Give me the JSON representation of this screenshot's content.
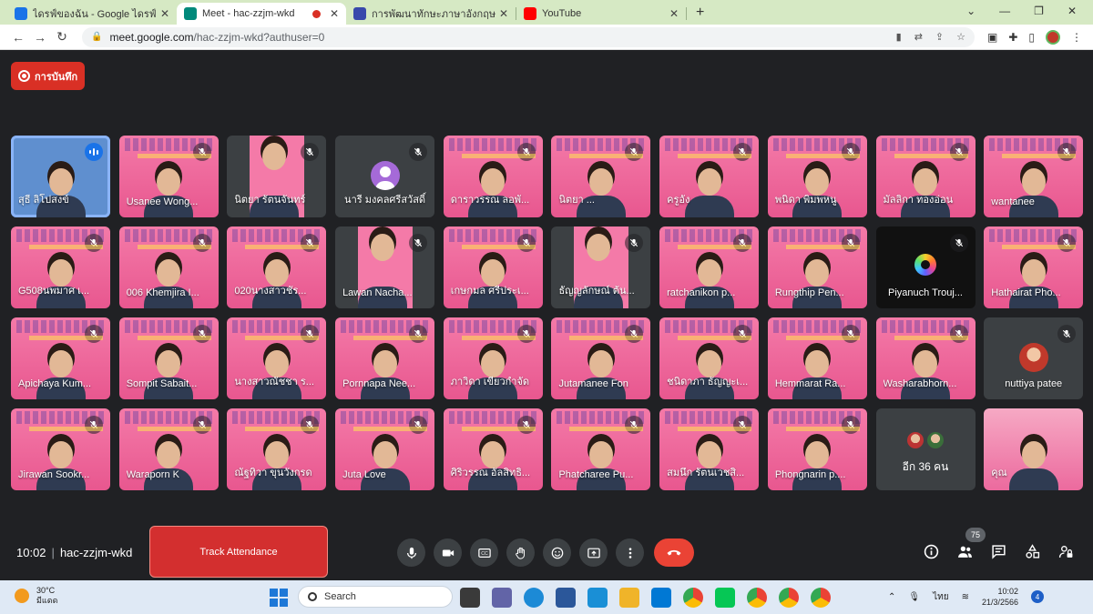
{
  "browser": {
    "tabs": [
      {
        "title": "ไดรฟ์ของฉัน - Google ไดรฟ์",
        "icon": "drive-icon",
        "color": "#1a73e8"
      },
      {
        "title": "Meet - hac-zzjm-wkd",
        "icon": "meet-icon",
        "color": "#00897b"
      },
      {
        "title": "การพัฒนาทักษะภาษาอังกฤษ English",
        "icon": "forms-icon",
        "color": "#3949ab"
      },
      {
        "title": "YouTube",
        "icon": "youtube-icon",
        "color": "#ff0000"
      }
    ],
    "url_host": "meet.google.com",
    "url_path": "/hac-zzjm-wkd?authuser=0"
  },
  "recording": {
    "label": "การบันทึก"
  },
  "participants": [
    {
      "name": "สุธี ลิโปสงข์",
      "style": "active-speaker",
      "speaking": true
    },
    {
      "name": "Usanee Wong...",
      "style": "slide"
    },
    {
      "name": "นิตยา รัตนจันทร์",
      "style": "dark-photo"
    },
    {
      "name": "นารี มงคลศรีสวัสดิ์",
      "style": "avatar"
    },
    {
      "name": "ดาราวรรณ ลอพั...",
      "style": "slide"
    },
    {
      "name": "นิตยา ...",
      "style": "slide"
    },
    {
      "name": "ครูอัง",
      "style": "slide"
    },
    {
      "name": "พนิดา พิมพหนู",
      "style": "slide"
    },
    {
      "name": "มัลลิกา ทองอ่อน",
      "style": "slide"
    },
    {
      "name": "wantanee",
      "style": "slide"
    },
    {
      "name": "G508นพมาศ เ...",
      "style": "slide"
    },
    {
      "name": "006 Khemjira I...",
      "style": "slide"
    },
    {
      "name": "020นางสาวชัร...",
      "style": "slide"
    },
    {
      "name": "Lawan Nacha...",
      "style": "dark-photo"
    },
    {
      "name": "เกษกมล ศรีประเ...",
      "style": "slide"
    },
    {
      "name": "ธัญญลักษณ์ ต้น...",
      "style": "dark-photo"
    },
    {
      "name": "ratchanikon p...",
      "style": "slide"
    },
    {
      "name": "Rungthip Pen...",
      "style": "slide"
    },
    {
      "name": "Piyanuch Trouj...",
      "style": "logo"
    },
    {
      "name": "Hathairat Pho...",
      "style": "slide"
    },
    {
      "name": "Apichaya Kum...",
      "style": "slide"
    },
    {
      "name": "Sompit Sabait...",
      "style": "slide"
    },
    {
      "name": "นางสาวณัชชา ร...",
      "style": "slide"
    },
    {
      "name": "Pornnapa Nee...",
      "style": "slide"
    },
    {
      "name": "ภาวิดา เขียวกำจัด",
      "style": "slide"
    },
    {
      "name": "Jutamanee Fon",
      "style": "slide"
    },
    {
      "name": "ชนิดาภา ธัญญะเ...",
      "style": "slide"
    },
    {
      "name": "Hemmarat Ra...",
      "style": "slide"
    },
    {
      "name": "Washarabhorn...",
      "style": "slide"
    },
    {
      "name": "nuttiya patee",
      "style": "photo-avatar"
    },
    {
      "name": "Jirawan Sookr...",
      "style": "slide"
    },
    {
      "name": "Waraporn K",
      "style": "slide"
    },
    {
      "name": "ณัฐทิวา ขุนวังกรด",
      "style": "slide"
    },
    {
      "name": "Juta Love",
      "style": "slide"
    },
    {
      "name": "ศิริวรรณ อัลสิทธิ...",
      "style": "slide"
    },
    {
      "name": "Phatcharee Pu...",
      "style": "slide"
    },
    {
      "name": "สมนึก รัตนเวชสิ...",
      "style": "room"
    },
    {
      "name": "Phongnarin p....",
      "style": "slide"
    },
    {
      "name": "อีก 36 คน",
      "style": "more"
    },
    {
      "name": "คุณ",
      "style": "self"
    }
  ],
  "bottom": {
    "time": "10:02",
    "meeting_code": "hac-zzjm-wkd",
    "track_label": "Track Attendance",
    "people_count": "75"
  },
  "taskbar": {
    "temperature": "30°C",
    "weather": "มีแดด",
    "search_placeholder": "Search",
    "language": "ไทย",
    "clock_time": "10:02",
    "clock_date": "21/3/2566",
    "notifications": "4"
  }
}
